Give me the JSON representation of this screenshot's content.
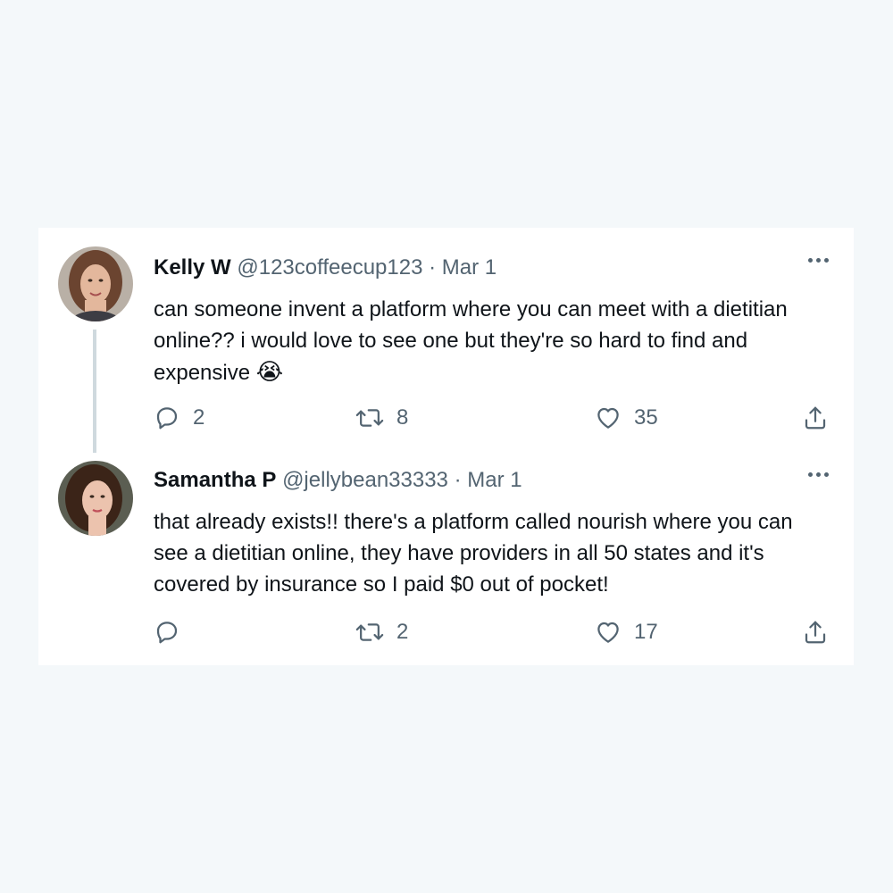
{
  "tweets": [
    {
      "name": "Kelly W",
      "handle": "@123coffeecup123",
      "separator": "·",
      "date": "Mar 1",
      "text": "can someone invent a platform where you can meet with a dietitian online?? i would love to see one but they're so hard to find and expensive",
      "emoji": "😭",
      "reply_count": "2",
      "retweet_count": "8",
      "like_count": "35",
      "avatar_icon": "avatar-photo"
    },
    {
      "name": "Samantha P",
      "handle": "@jellybean33333",
      "separator": "·",
      "date": "Mar 1",
      "text": "that already exists!! there's a platform called nourish where you can see a dietitian online, they have providers in all 50 states and it's covered by insurance so I paid $0 out of pocket!",
      "reply_count": "",
      "retweet_count": "2",
      "like_count": "17",
      "avatar_icon": "avatar-photo"
    }
  ],
  "colors": {
    "background": "#f4f8fa",
    "card": "#ffffff",
    "text": "#0f1419",
    "secondary": "#536471",
    "thread_line": "#cfd9de"
  }
}
